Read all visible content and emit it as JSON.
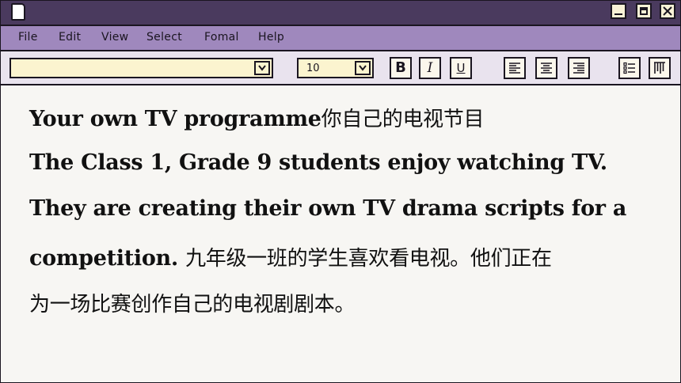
{
  "menu": {
    "items": [
      "File",
      "Edit",
      "View",
      "Select",
      "Fomal",
      "Help"
    ]
  },
  "toolbar": {
    "font_value": "",
    "size_value": "10",
    "bold_label": "B",
    "italic_label": "I",
    "underline_label": "U"
  },
  "document": {
    "line1_en": "Your own TV programme",
    "line1_zh": "你自己的电视节目",
    "line2_en": "The Class 1, Grade 9 students enjoy watching TV.",
    "line3_en": "They are creating their own TV drama scripts for a",
    "line4_en": "competition. ",
    "line4_zh": "九年级一班的学生喜欢看电视。他们正在",
    "line5_zh": "为一场比赛创作自己的电视剧剧本。"
  }
}
